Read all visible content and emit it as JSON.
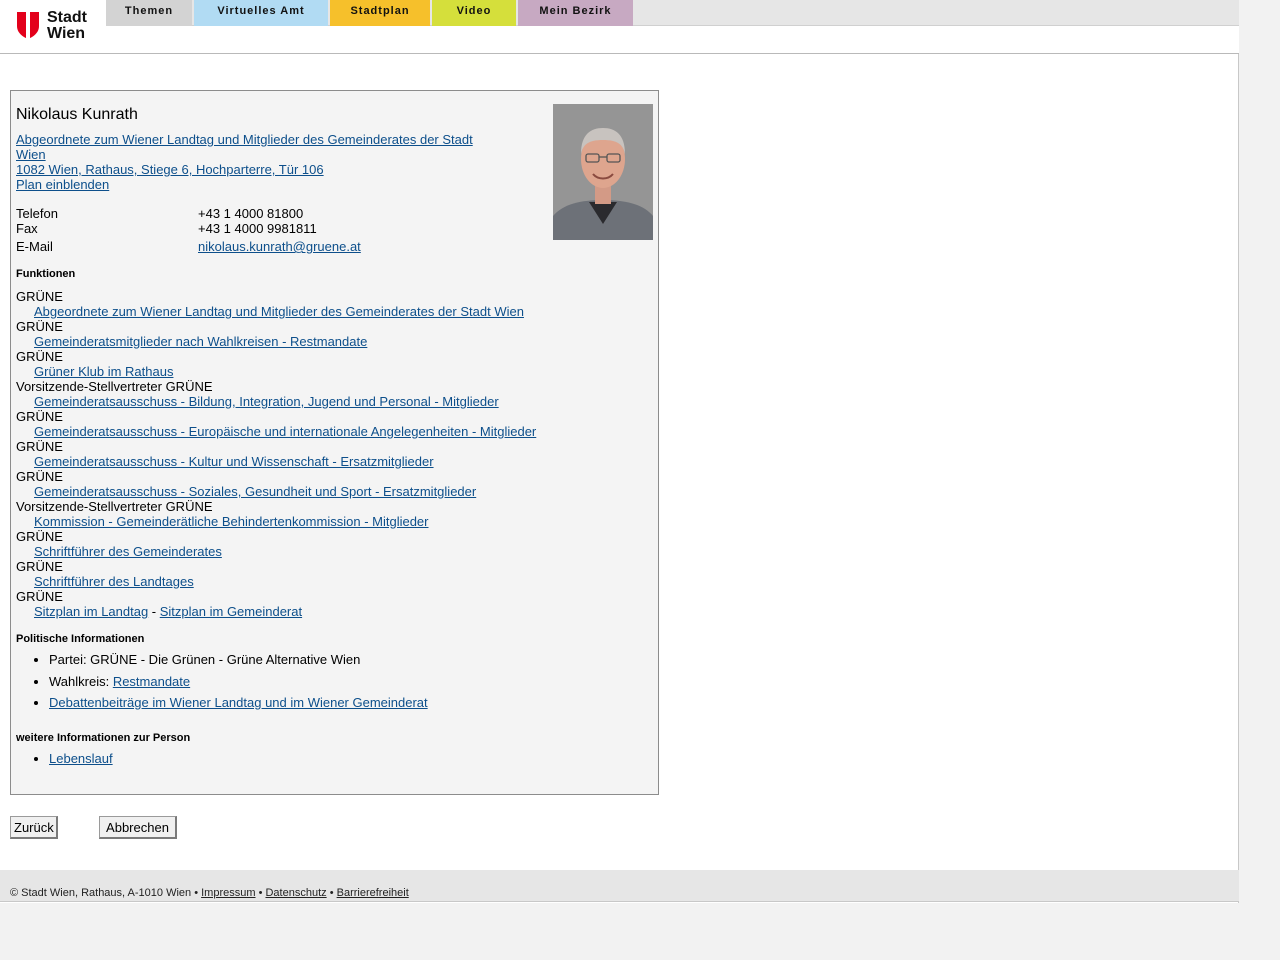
{
  "logo": {
    "line1": "Stadt",
    "line2": "Wien"
  },
  "nav": [
    "Themen",
    "Virtuelles Amt",
    "Stadtplan",
    "Video",
    "Mein Bezirk"
  ],
  "person": {
    "name": "Nikolaus Kunrath",
    "intro_line1": "Abgeordnete zum Wiener Landtag und Mitglieder des Gemeinderates der Stadt",
    "intro_line2": "Wien",
    "address": "1082 Wien, Rathaus, Stiege 6, Hochparterre, Tür 106",
    "plan_link": "Plan einblenden",
    "photo_icon": "person-photo"
  },
  "contact": {
    "phone_label": "Telefon",
    "phone": "+43 1 4000 81800",
    "fax_label": "Fax",
    "fax": "+43 1 4000 9981811",
    "email_label": "E-Mail",
    "email": "nikolaus.kunrath@gruene.at"
  },
  "funktionen": {
    "heading": "Funktionen",
    "items": [
      {
        "role": "GRÜNE",
        "link": "Abgeordnete zum Wiener Landtag und Mitglieder des Gemeinderates der Stadt Wien"
      },
      {
        "role": "GRÜNE",
        "link": "Gemeinderatsmitglieder nach Wahlkreisen - Restmandate"
      },
      {
        "role": "GRÜNE",
        "link": "Grüner Klub im Rathaus"
      },
      {
        "role": "Vorsitzende-Stellvertreter GRÜNE",
        "link": "Gemeinderatsausschuss - Bildung, Integration, Jugend und Personal - Mitglieder"
      },
      {
        "role": "GRÜNE",
        "link": "Gemeinderatsausschuss - Europäische und internationale Angelegenheiten - Mitglieder"
      },
      {
        "role": "GRÜNE",
        "link": "Gemeinderatsausschuss - Kultur und Wissenschaft - Ersatzmitglieder"
      },
      {
        "role": "GRÜNE",
        "link": "Gemeinderatsausschuss - Soziales, Gesundheit und Sport - Ersatzmitglieder"
      },
      {
        "role": "Vorsitzende-Stellvertreter GRÜNE",
        "link": "Kommission - Gemeinderätliche Behindertenkommission - Mitglieder"
      },
      {
        "role": "GRÜNE",
        "link": "Schriftführer des Gemeinderates"
      },
      {
        "role": "GRÜNE",
        "link": "Schriftführer des Landtages"
      }
    ],
    "last_role": "GRÜNE",
    "sitzplan_landtag": "Sitzplan im Landtag",
    "separator": " - ",
    "sitzplan_gemeinderat": "Sitzplan im Gemeinderat"
  },
  "political": {
    "heading": "Politische Informationen",
    "party": "Partei: GRÜNE - Die Grünen - Grüne Alternative Wien",
    "wahlkreis_label": "Wahlkreis: ",
    "wahlkreis_link": "Restmandate",
    "debates_link": "Debattenbeiträge im Wiener Landtag und im Wiener Gemeinderat"
  },
  "more": {
    "heading": "weitere Informationen zur Person",
    "lebenslauf": "Lebenslauf"
  },
  "buttons": {
    "back": "Zurück",
    "cancel": "Abbrechen"
  },
  "footer": {
    "copyright": "© Stadt Wien, Rathaus, A-1010 Wien",
    "sep": " • ",
    "impressum": "Impressum",
    "datenschutz": "Datenschutz",
    "barrierefreiheit": "Barrierefreiheit"
  },
  "colors": {
    "link": "#0d4f8b",
    "nav_themen": "#d3d3d3",
    "nav_amt": "#b1dbf3",
    "nav_plan": "#f6c02b",
    "nav_video": "#d5df3b",
    "nav_bezirk": "#c7a9c2",
    "logo_red": "#e3001b"
  }
}
